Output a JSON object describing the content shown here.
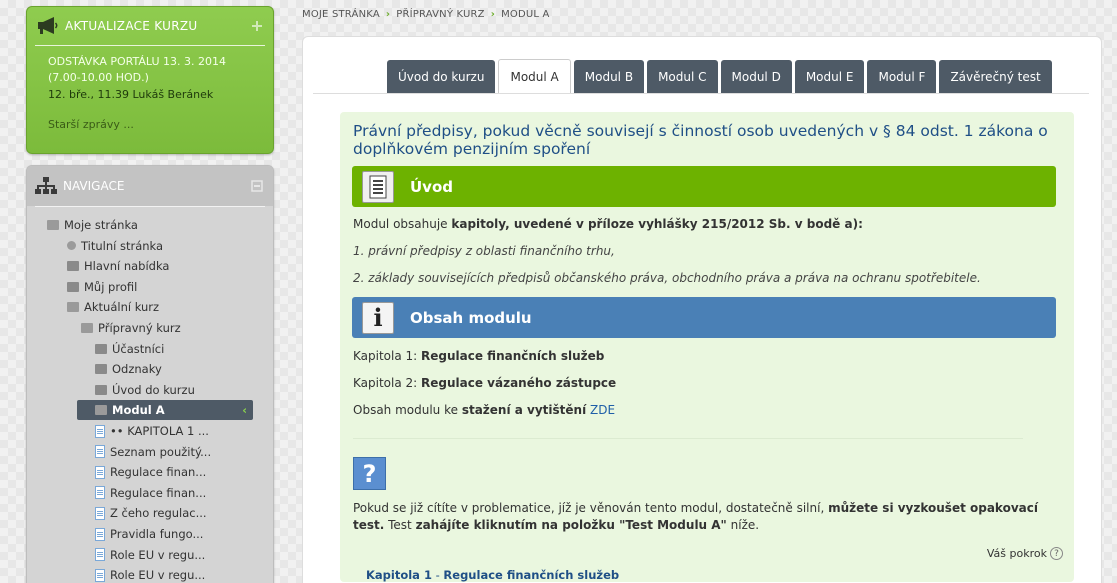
{
  "news": {
    "title": "AKTUALIZACE KURZU",
    "icon": "megaphone-icon",
    "item_title_line1": "ODSTÁVKA PORTÁLU 13. 3. 2014",
    "item_title_line2": "(7.00-10.00 HOD.)",
    "item_meta": "12. bře., 11.39 Lukáš Beránek",
    "older": "Starší zprávy ..."
  },
  "nav": {
    "title": "NAVIGACE",
    "icon": "sitemap-icon",
    "items": [
      {
        "label": "Moje stránka",
        "icon": "folder-open-icon"
      },
      {
        "label": "Titulní stránka",
        "icon": "dot-icon"
      },
      {
        "label": "Hlavní nabídka",
        "icon": "folder-icon"
      },
      {
        "label": "Můj profil",
        "icon": "folder-icon"
      },
      {
        "label": "Aktuální kurz",
        "icon": "folder-open-icon"
      },
      {
        "label": "Přípravný kurz",
        "icon": "folder-open-icon"
      },
      {
        "label": "Účastníci",
        "icon": "folder-icon"
      },
      {
        "label": "Odznaky",
        "icon": "folder-icon"
      },
      {
        "label": "Úvod do kurzu",
        "icon": "folder-icon"
      },
      {
        "label": "Modul A",
        "icon": "folder-open-icon",
        "active": true
      },
      {
        "label": "•• KAPITOLA 1 ...",
        "icon": "page-icon"
      },
      {
        "label": "Seznam použitý...",
        "icon": "page-icon"
      },
      {
        "label": "Regulace finan...",
        "icon": "page-icon"
      },
      {
        "label": "Regulace finan...",
        "icon": "page-icon"
      },
      {
        "label": "Z čeho regulac...",
        "icon": "page-icon"
      },
      {
        "label": "Pravidla fungo...",
        "icon": "page-icon"
      },
      {
        "label": "Role EU v regu...",
        "icon": "page-icon"
      },
      {
        "label": "Role EU v regu...",
        "icon": "page-icon"
      }
    ]
  },
  "breadcrumb": [
    "MOJE STRÁNKA",
    "PŘÍPRAVNÝ KURZ",
    "MODUL A"
  ],
  "tabs": [
    "Úvod do kurzu",
    "Modul A",
    "Modul B",
    "Modul C",
    "Modul D",
    "Modul E",
    "Modul F",
    "Závěrečný test"
  ],
  "active_tab": "Modul A",
  "section": {
    "title": "Právní předpisy, pokud věcně souvisejí s činností osob uvedených v § 84 odst. 1 zákona o doplňkovém penzijním spoření",
    "uvod_label": "Úvod",
    "modul_intro_a": "Modul obsahuje ",
    "modul_intro_b": "kapitoly, uvedené v příloze vyhlášky 215/2012 Sb. v bodě a):",
    "point1": "1. právní předpisy z oblasti finančního trhu,",
    "point2": "2. základy souvisejících předpisů občanského práva, obchodního práva a práva na ochranu spotřebitele.",
    "obsah_label": "Obsah modulu",
    "k1_prefix": "Kapitola 1: ",
    "k1_title": "Regulace finančních služeb",
    "k2_prefix": "Kapitola 2: ",
    "k2_title": "Regulace vázaného zástupce",
    "dl_a": "Obsah modulu ke ",
    "dl_b": "stažení a vytištění",
    "dl_c": " ZDE",
    "q_mark": "?",
    "q_text_a": "Pokud se již cítíte v problematice, jíž je věnován tento modul, dostatečně silní, ",
    "q_text_b": "můžete si vyzkoušet opakovací test.",
    "q_text_c": " Test ",
    "q_text_d": "zahájíte kliknutím na položku \"Test Modulu A\"",
    "q_text_e": " níže."
  },
  "progress_label": "Váš pokrok",
  "chapter1_a": "Kapitola 1",
  "chapter1_b": " - ",
  "chapter1_c": "Regulace finančních služeb",
  "colors": {
    "green_bar": "#6db200",
    "blue_bar": "#4a80b6",
    "tab_bg": "#4e5a66",
    "section_bg": "#eaf7df",
    "title_blue": "#1f4f86"
  }
}
